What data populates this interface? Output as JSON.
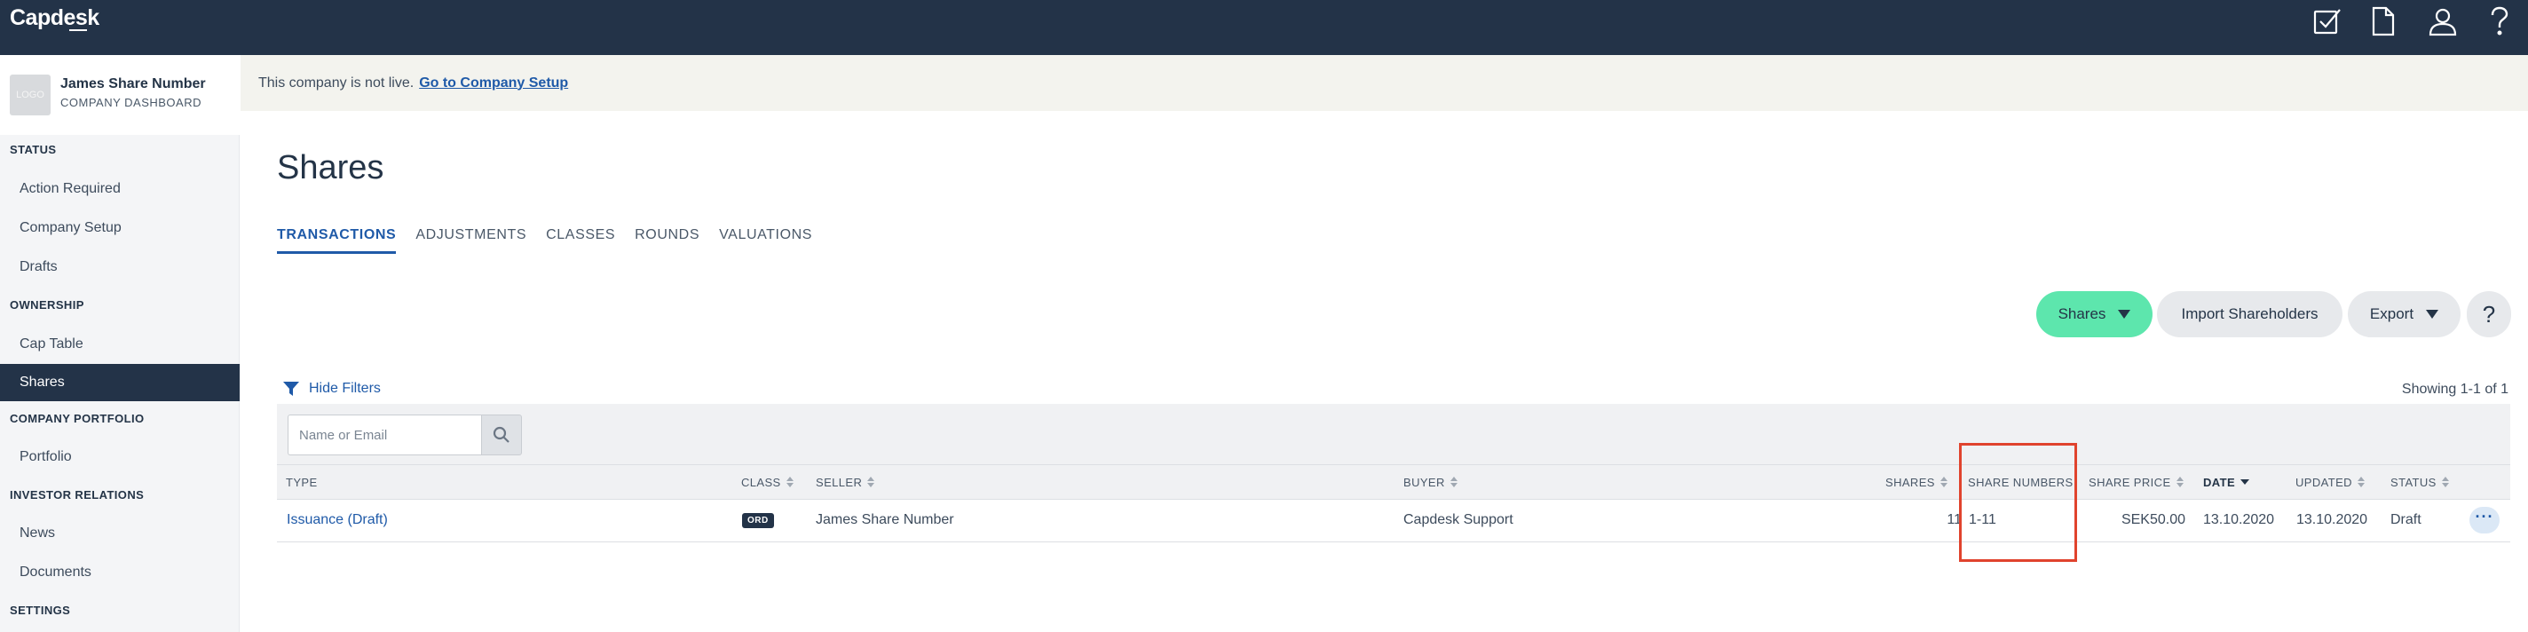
{
  "topbar": {
    "brand": "Capdesk",
    "icons": [
      "checkbox-icon",
      "document-icon",
      "user-icon",
      "help-icon"
    ]
  },
  "sidebar": {
    "company_name": "James Share Number",
    "company_subtitle": "COMPANY DASHBOARD",
    "logo_text": "LOGO",
    "sections": {
      "status": "STATUS",
      "ownership": "OWNERSHIP",
      "portfolio": "COMPANY PORTFOLIO",
      "investor": "INVESTOR RELATIONS",
      "settings": "SETTINGS"
    },
    "items": {
      "action_required": "Action Required",
      "company_setup": "Company Setup",
      "drafts": "Drafts",
      "cap_table": "Cap Table",
      "shares": "Shares",
      "portfolio": "Portfolio",
      "news": "News",
      "documents": "Documents"
    }
  },
  "notice": {
    "text": "This company is not live.",
    "link": "Go to Company Setup"
  },
  "page": {
    "title": "Shares",
    "tabs": [
      "TRANSACTIONS",
      "ADJUSTMENTS",
      "CLASSES",
      "ROUNDS",
      "VALUATIONS"
    ],
    "active_tab": "TRANSACTIONS"
  },
  "actions": {
    "shares": "Shares",
    "import": "Import Shareholders",
    "export": "Export",
    "help": "?"
  },
  "filters": {
    "toggle": "Hide Filters",
    "search_placeholder": "Name or Email",
    "showing": "Showing 1-1 of 1"
  },
  "table": {
    "headers": {
      "type": "TYPE",
      "class": "CLASS",
      "seller": "SELLER",
      "buyer": "BUYER",
      "shares": "SHARES",
      "share_numbers": "SHARE NUMBERS",
      "share_price": "SHARE PRICE",
      "date": "DATE",
      "updated": "UPDATED",
      "status": "STATUS"
    },
    "rows": [
      {
        "type": "Issuance (Draft)",
        "class": "ORD",
        "seller": "James Share Number",
        "buyer": "Capdesk Support",
        "shares": "11",
        "share_numbers": "1-11",
        "share_price": "SEK50.00",
        "date": "13.10.2020",
        "updated": "13.10.2020",
        "status": "Draft",
        "more": "···"
      }
    ]
  },
  "colors": {
    "topbar": "#233348",
    "accent": "#1f5aa8",
    "primary_button": "#5de6ad",
    "highlight": "#e0432d"
  }
}
